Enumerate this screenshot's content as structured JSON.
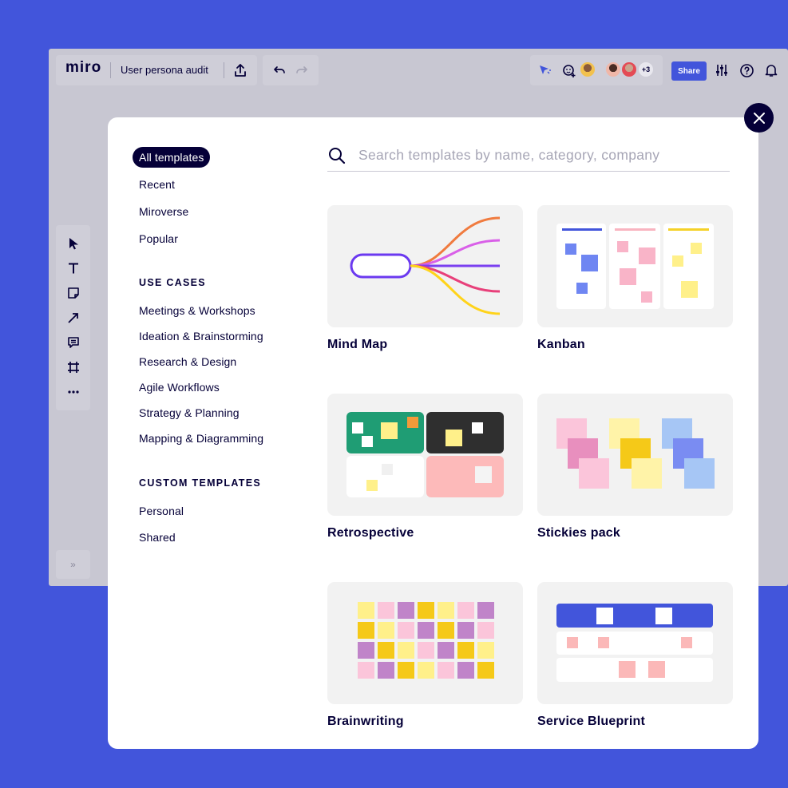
{
  "app": {
    "logo": "miro",
    "board_title": "User persona audit"
  },
  "collaborators": {
    "extra_count": "+3"
  },
  "toolbar": {
    "share_label": "Share"
  },
  "tools": [
    "select-tool",
    "text-tool",
    "sticky-note-tool",
    "line-tool",
    "comment-tool",
    "frame-tool",
    "more-tools"
  ],
  "modal": {
    "search_placeholder": "Search templates by name, category, company",
    "nav": {
      "all": "All templates",
      "recent": "Recent",
      "miroverse": "Miroverse",
      "popular": "Popular",
      "use_cases_heading": "USE CASES",
      "use_cases": [
        "Meetings & Workshops",
        "Ideation & Brainstorming",
        "Research & Design",
        "Agile Workflows",
        "Strategy & Planning",
        "Mapping & Diagramming"
      ],
      "custom_heading": "CUSTOM TEMPLATES",
      "custom": [
        "Personal",
        "Shared"
      ]
    },
    "templates": [
      {
        "title": "Mind Map"
      },
      {
        "title": "Kanban"
      },
      {
        "title": "Retrospective"
      },
      {
        "title": "Stickies pack"
      },
      {
        "title": "Brainwriting"
      },
      {
        "title": "Service Blueprint"
      }
    ]
  },
  "colors": {
    "brand": "#4255DB",
    "ink": "#050038",
    "canvas": "#C8C7D2"
  }
}
